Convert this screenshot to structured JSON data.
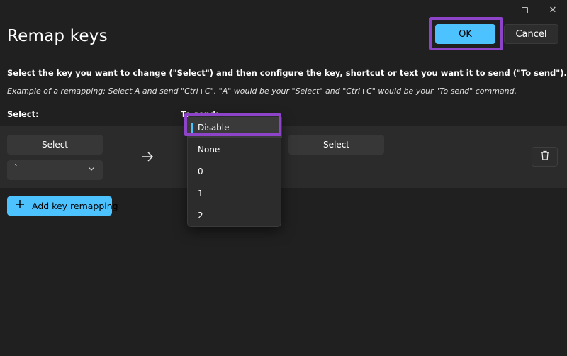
{
  "window": {
    "title": "Remap keys",
    "caption": {
      "maximize_icon": "maximize-icon",
      "close_glyph": "✕"
    }
  },
  "actions": {
    "ok_label": "OK",
    "cancel_label": "Cancel"
  },
  "instructions": {
    "main": "Select the key you want to change (\"Select\") and then configure the key, shortcut or text you want it to send (\"To send\").",
    "example": "Example of a remapping: Select A and send \"Ctrl+C\", \"A\" would be your \"Select\" and \"Ctrl+C\" would be your \"To send\" command."
  },
  "columns": {
    "select": "Select:",
    "to_send": "To send:"
  },
  "mapping": {
    "select_button": "Select",
    "select_key_value": "`",
    "to_send_button": "Select",
    "arrow_icon": "arrow-right-icon",
    "delete_icon": "trash-icon"
  },
  "dropdown_menu": {
    "items": [
      {
        "label": "Disable",
        "selected": true
      },
      {
        "label": "None",
        "selected": false
      },
      {
        "label": "0",
        "selected": false
      },
      {
        "label": "1",
        "selected": false
      },
      {
        "label": "2",
        "selected": false
      }
    ]
  },
  "add_button": {
    "label": "Add key remapping",
    "icon": "plus-icon"
  },
  "colors": {
    "background": "#202020",
    "row_background": "#2b2b2b",
    "accent": "#4cc2ff",
    "highlight": "#8e44c8"
  }
}
